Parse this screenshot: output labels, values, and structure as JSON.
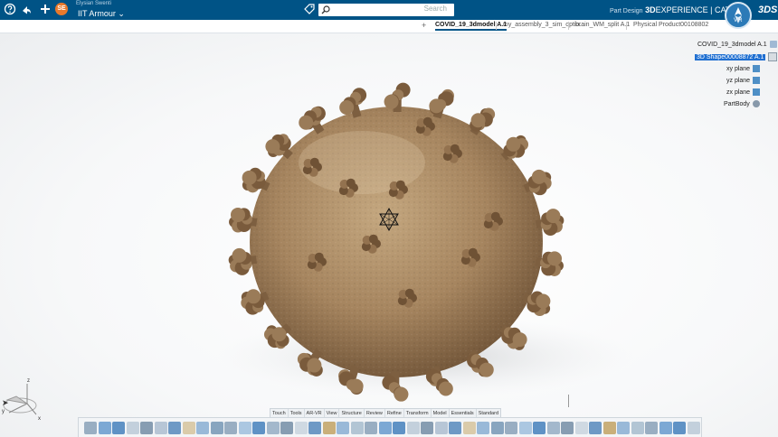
{
  "header": {
    "user_sub": "Elysian Swenti",
    "user_name": "IIT Armour",
    "user_initials": "SE",
    "search_placeholder": "Search",
    "brand_3d": "3D",
    "brand_rest": "EXPERIENCE | CATIA",
    "brand_app": "Part Design",
    "compass_version": "V.R",
    "ds_logo": "3DS"
  },
  "tabs": [
    {
      "label": "COVID_19_3dmodel A.1",
      "active": true
    },
    {
      "label": "my_assembly_3_sim_optio..."
    },
    {
      "label": "brain_WM_split A.1"
    },
    {
      "label": "Physical Product00108802"
    }
  ],
  "tree": {
    "root": "COVID_19_3dmodel A.1",
    "items": [
      {
        "label": "3D Shape00008872 A.1",
        "selected": true
      },
      {
        "label": "xy plane"
      },
      {
        "label": "yz plane"
      },
      {
        "label": "zx plane"
      },
      {
        "label": "PartBody"
      }
    ]
  },
  "axes": {
    "z": "z",
    "y": "y",
    "x": "x"
  },
  "action_bar_tabs": [
    "Standard",
    "Essentials",
    "Model",
    "Transform",
    "Refine",
    "Review",
    "Structure",
    "View",
    "AR-VR",
    "Tools",
    "Touch"
  ],
  "colors": {
    "topbar": "#005386",
    "virus_body": "#a6855f",
    "spike": "#8c6a48",
    "selection": "#1f6fd1"
  },
  "icons": [
    "home-icon",
    "share-icon",
    "add-icon",
    "tag-icon",
    "search-icon",
    "compass-icon",
    "help-icon"
  ]
}
